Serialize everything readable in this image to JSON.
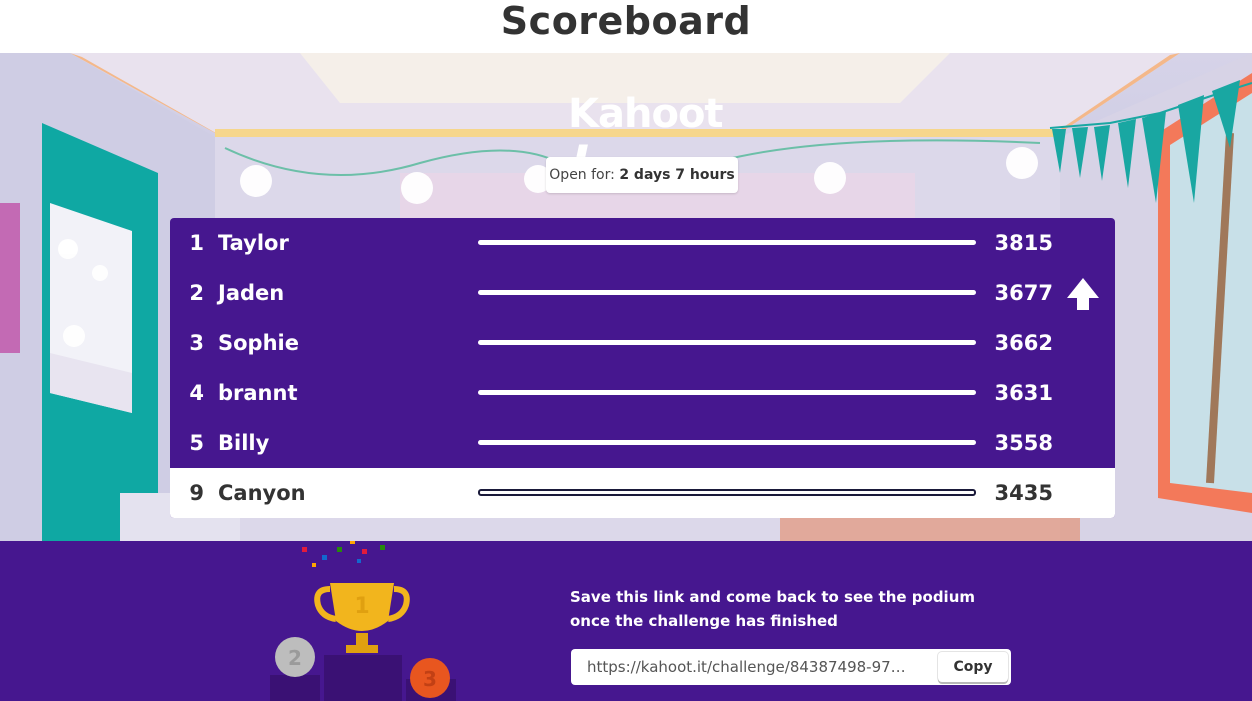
{
  "page": {
    "title": "Scoreboard"
  },
  "logo": {
    "text": "Kahoot",
    "bang": "!"
  },
  "open_for": {
    "label": "Open for:",
    "value": "2 days 7 hours"
  },
  "leaderboard": {
    "rows": [
      {
        "rank": "1",
        "name": "Taylor",
        "score": "3815"
      },
      {
        "rank": "2",
        "name": "Jaden",
        "score": "3677"
      },
      {
        "rank": "3",
        "name": "Sophie",
        "score": "3662"
      },
      {
        "rank": "4",
        "name": "brannt",
        "score": "3631"
      },
      {
        "rank": "5",
        "name": "Billy",
        "score": "3558"
      },
      {
        "rank": "9",
        "name": "Canyon",
        "score": "3435"
      }
    ],
    "arrow_icon": "arrow-up-icon"
  },
  "footer": {
    "message_line1": "Save this link and come back to see the podium",
    "message_line2": "once the challenge has finished",
    "link_value": "https://kahoot.it/challenge/84387498-97…",
    "copy_label": "Copy",
    "trophy": {
      "first": "1",
      "second": "2",
      "third": "3"
    }
  },
  "colors": {
    "brand_purple": "#46178f",
    "title_text": "#333333",
    "trophy_gold": "#f2b51d",
    "bronze": "#e8561f",
    "silver": "#bdbdbd"
  }
}
